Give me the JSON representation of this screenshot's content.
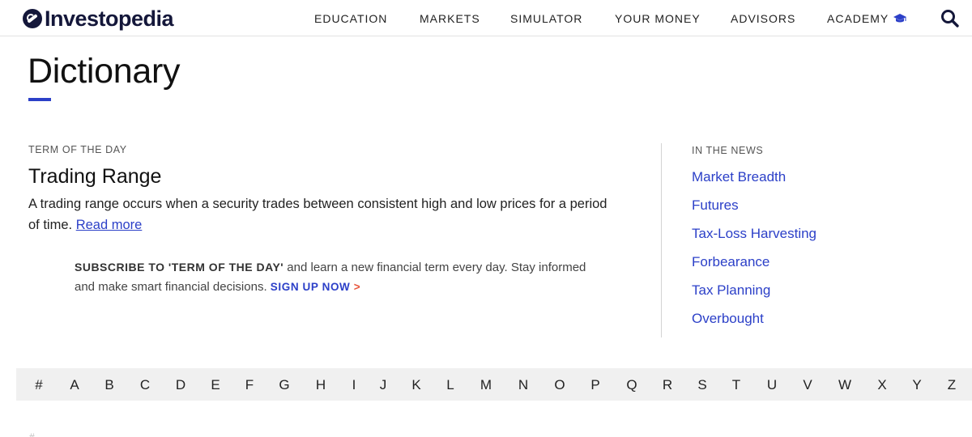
{
  "brand": {
    "name": "Investopedia",
    "color": "#14173a",
    "accent": "#2c40c8",
    "chevron_color": "#e8553b"
  },
  "nav": {
    "items": [
      {
        "label": "EDUCATION"
      },
      {
        "label": "MARKETS"
      },
      {
        "label": "SIMULATOR"
      },
      {
        "label": "YOUR MONEY"
      },
      {
        "label": "ADVISORS"
      },
      {
        "label": "ACADEMY",
        "icon": "graduation-cap-icon"
      }
    ],
    "search_icon": "search-icon"
  },
  "page": {
    "title": "Dictionary"
  },
  "term_of_day": {
    "label": "TERM OF THE DAY",
    "title": "Trading Range",
    "description": "A trading range occurs when a security trades between consistent high and low prices for a period of time.",
    "read_more": "Read more"
  },
  "subscribe": {
    "strong": "SUBSCRIBE TO 'TERM OF THE DAY'",
    "text": " and learn a new financial term every day. Stay informed and make smart financial decisions. ",
    "cta": "SIGN UP NOW",
    "cta_chevron": ">"
  },
  "in_the_news": {
    "label": "IN THE NEWS",
    "items": [
      "Market Breadth",
      "Futures",
      "Tax-Loss Harvesting",
      "Forbearance",
      "Tax Planning",
      "Overbought"
    ]
  },
  "alphabet": [
    "#",
    "A",
    "B",
    "C",
    "D",
    "E",
    "F",
    "G",
    "H",
    "I",
    "J",
    "K",
    "L",
    "M",
    "N",
    "O",
    "P",
    "Q",
    "R",
    "S",
    "T",
    "U",
    "V",
    "W",
    "X",
    "Y",
    "Z"
  ],
  "footer_hint": "#"
}
